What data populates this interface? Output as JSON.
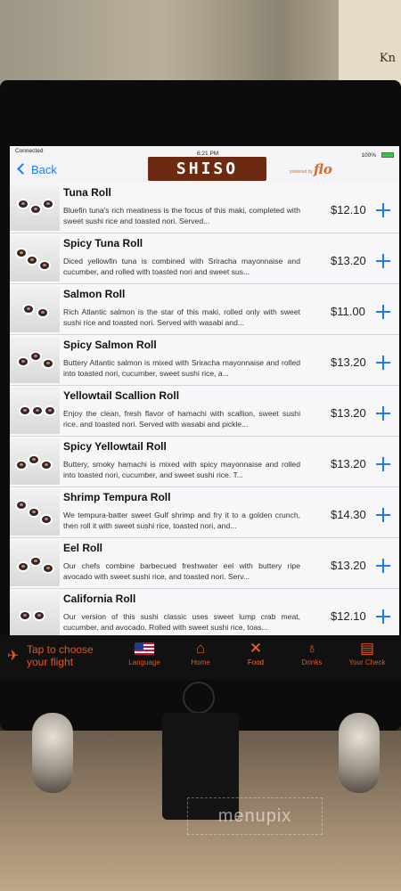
{
  "status_bar": {
    "carrier": "Connected",
    "time": "6:21 PM",
    "battery": "100%"
  },
  "header": {
    "back_label": "Back",
    "logo_text": "SHISO",
    "powered_by": "powered by",
    "brand": "flo"
  },
  "menu_items": [
    {
      "name": "Tuna Roll",
      "description": "Bluefin tuna's rich meatiness is the focus of this maki, completed with sweet sushi rice and toasted nori. Served...",
      "price": "$12.10"
    },
    {
      "name": "Spicy Tuna Roll",
      "description": "Diced yellowfin tuna is combined with Sriracha mayonnaise and cucumber, and rolled with toasted nori and sweet sus...",
      "price": "$13.20"
    },
    {
      "name": "Salmon Roll",
      "description": "Rich Atlantic salmon is the star of this maki, rolled only with sweet sushi rice and toasted nori. Served with wasabi and...",
      "price": "$11.00"
    },
    {
      "name": "Spicy Salmon Roll",
      "description": "Buttery Atlantic salmon is mixed with Sriracha mayonnaise and rolled into toasted nori, cucumber, sweet sushi rice, a...",
      "price": "$13.20"
    },
    {
      "name": "Yellowtail Scallion Roll",
      "description": "Enjoy the clean, fresh flavor of hamachi with scallion, sweet sushi rice, and toasted nori. Served with wasabi and pickle...",
      "price": "$13.20"
    },
    {
      "name": "Spicy Yellowtail Roll",
      "description": "Buttery, smoky hamachi is mixed with spicy mayonnaise and rolled into toasted nori, cucumber, and sweet sushi rice. T...",
      "price": "$13.20"
    },
    {
      "name": "Shrimp Tempura Roll",
      "description": "We tempura-batter sweet Gulf shrimp and fry it to a golden crunch, then roll it with sweet sushi rice, toasted nori, and...",
      "price": "$14.30"
    },
    {
      "name": "Eel Roll",
      "description": "Our chefs combine barbecued freshwater eel with buttery ripe avocado with sweet sushi rice, and toasted nori. Serv...",
      "price": "$13.20"
    },
    {
      "name": "California Roll",
      "description": "Our version of this sushi classic uses sweet lump crab meat, cucumber, and avocado. Rolled with sweet sushi rice, toas...",
      "price": "$12.10"
    }
  ],
  "toolbar": {
    "flight_label": "Tap to choose your flight",
    "tabs": [
      {
        "label": "Language",
        "icon": "us-flag-icon"
      },
      {
        "label": "Home",
        "icon": "home-icon"
      },
      {
        "label": "Food",
        "icon": "utensils-icon"
      },
      {
        "label": "Drinks",
        "icon": "wine-glass-icon"
      },
      {
        "label": "Your Check",
        "icon": "receipt-icon"
      }
    ],
    "accent_color": "#e8541e"
  },
  "watermark": "menupix",
  "wall_sign": "Kn"
}
